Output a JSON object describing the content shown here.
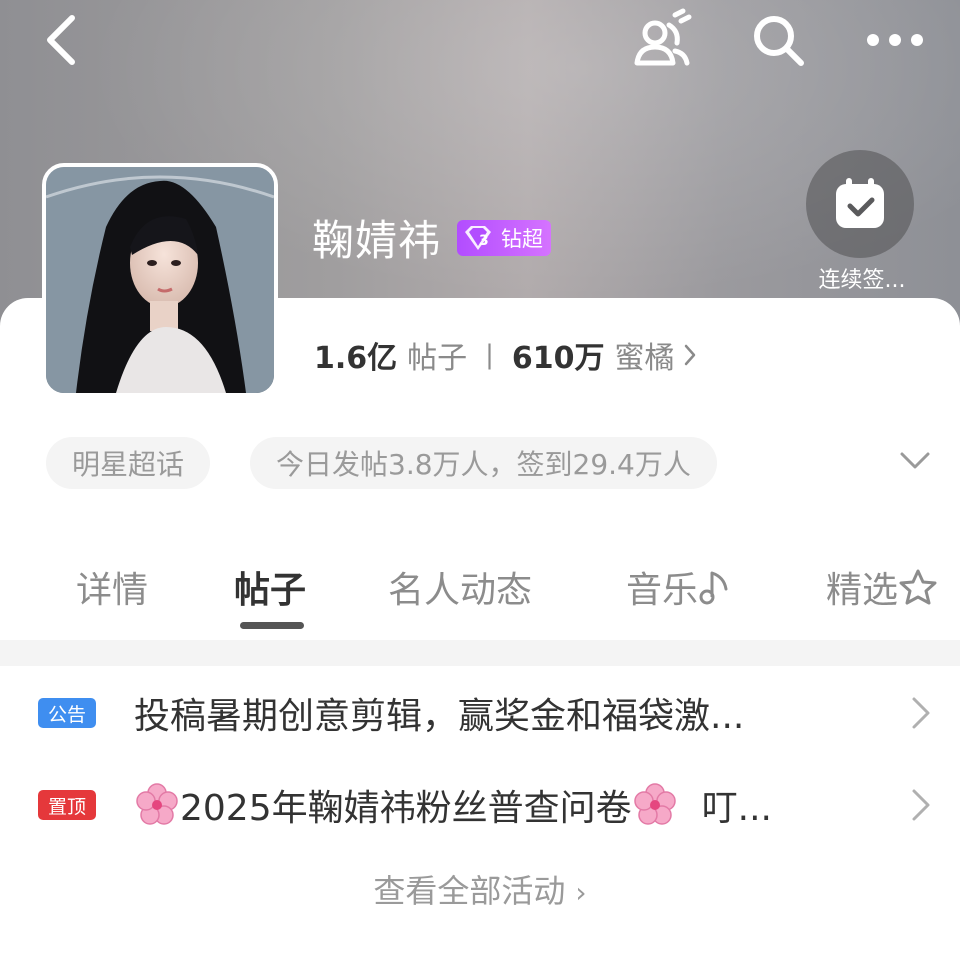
{
  "header": {
    "title": "鞠婧祎",
    "badge_label": "钻超",
    "checkin_label": "连续签..."
  },
  "stats": {
    "posts_count": "1.6亿",
    "posts_label": "帖子",
    "fans_count": "610万",
    "fans_label": "蜜橘"
  },
  "pills": {
    "category": "明星超话",
    "today": "今日发帖3.8万人，签到29.4万人"
  },
  "tabs": [
    {
      "label": "详情"
    },
    {
      "label": "帖子",
      "active": true
    },
    {
      "label": "名人动态"
    },
    {
      "label": "音乐"
    },
    {
      "label": "精选"
    }
  ],
  "list": {
    "items": [
      {
        "tag": "公告",
        "tag_color": "#3f8ef0",
        "text": "投稿暑期创意剪辑，赢奖金和福袋激..."
      },
      {
        "tag": "置顶",
        "tag_color": "#e5383b",
        "text_main": "2025年鞠婧祎粉丝普查问卷",
        "text_tail": "叮..."
      }
    ],
    "view_all": "查看全部活动"
  },
  "icons": {
    "back": "back-icon",
    "people": "people-icon",
    "search": "search-icon",
    "more": "more-icon",
    "calendar": "calendar-check-icon",
    "gem": "diamond-gem-icon",
    "music": "music-note-icon",
    "featured": "featured-star-icon",
    "flower": "cherry-blossom-icon"
  },
  "colors": {
    "badge": "#b24dff",
    "announcement_tag": "#3f8ef0",
    "pinned_tag": "#e5383b"
  }
}
